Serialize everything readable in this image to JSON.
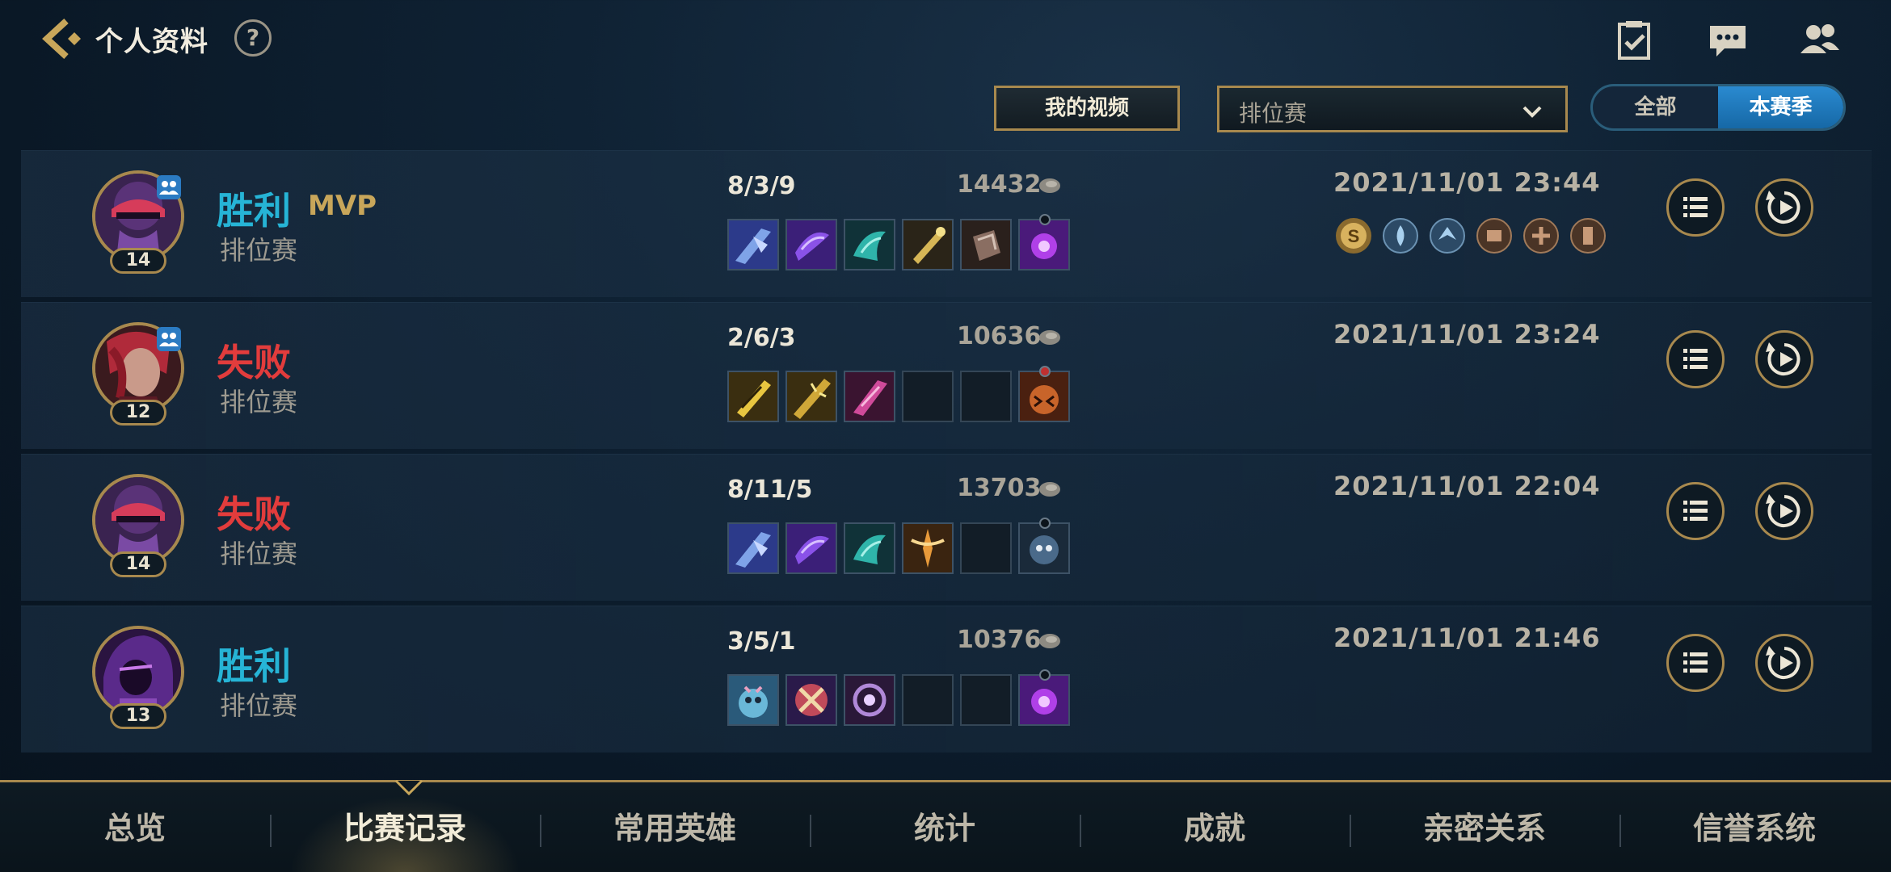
{
  "header": {
    "title": "个人资料",
    "help_label": "?"
  },
  "toolbar": {
    "video_label": "我的视频",
    "mode_select_value": "排位赛",
    "scope_all_label": "全部",
    "scope_season_label": "本赛季",
    "scope_selected": "本赛季"
  },
  "matches": [
    {
      "result": "胜利",
      "result_type": "win",
      "mvp": "MVP",
      "mode": "排位赛",
      "level": "14",
      "kda": "8/3/9",
      "gold": "14432",
      "time": "2021/11/01 23:44",
      "party": true,
      "medals": [
        "s-rank-medal",
        "flame-medal",
        "wing-medal",
        "gold-medal",
        "cross-medal",
        "tower-medal"
      ]
    },
    {
      "result": "失败",
      "result_type": "lose",
      "mvp": "",
      "mode": "排位赛",
      "level": "12",
      "kda": "2/6/3",
      "gold": "10636",
      "time": "2021/11/01 23:24",
      "party": true,
      "medals": []
    },
    {
      "result": "失败",
      "result_type": "lose",
      "mvp": "",
      "mode": "排位赛",
      "level": "14",
      "kda": "8/11/5",
      "gold": "13703",
      "time": "2021/11/01 22:04",
      "party": false,
      "medals": []
    },
    {
      "result": "胜利",
      "result_type": "win",
      "mvp": "",
      "mode": "排位赛",
      "level": "13",
      "kda": "3/5/1",
      "gold": "10376",
      "time": "2021/11/01 21:46",
      "party": false,
      "medals": []
    }
  ],
  "nav": {
    "items": [
      "总览",
      "比赛记录",
      "常用英雄",
      "统计",
      "成就",
      "亲密关系",
      "信誉系统"
    ],
    "active": "比赛记录"
  },
  "colors": {
    "gold_border": "#a8894e",
    "win": "#26b4d6",
    "lose": "#e23c3c",
    "accent_blue": "#1f7fc4"
  }
}
